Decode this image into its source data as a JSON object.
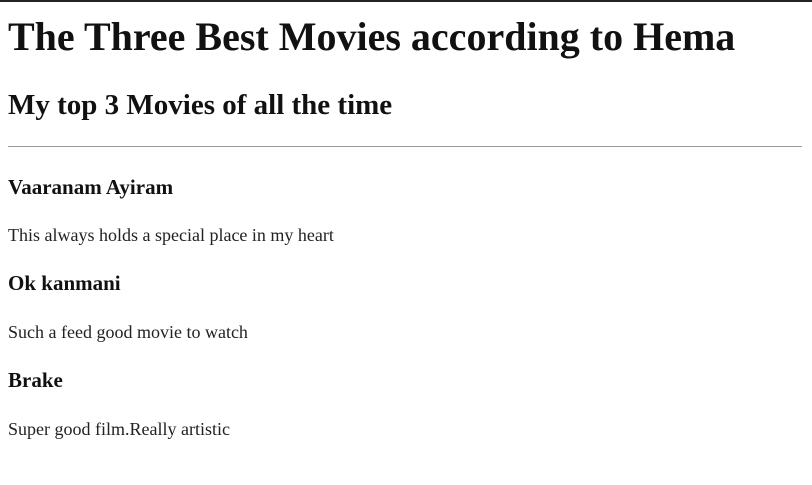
{
  "page": {
    "main_title": "The Three Best Movies according to Hema",
    "subtitle": "My top 3 Movies of all the time"
  },
  "movies": [
    {
      "title": "Vaaranam Ayiram",
      "description": "This always holds a special place in my heart"
    },
    {
      "title": "Ok kanmani",
      "description": "Such a feed good movie to watch"
    },
    {
      "title": "Brake",
      "description": "Super good film.Really artistic"
    }
  ]
}
